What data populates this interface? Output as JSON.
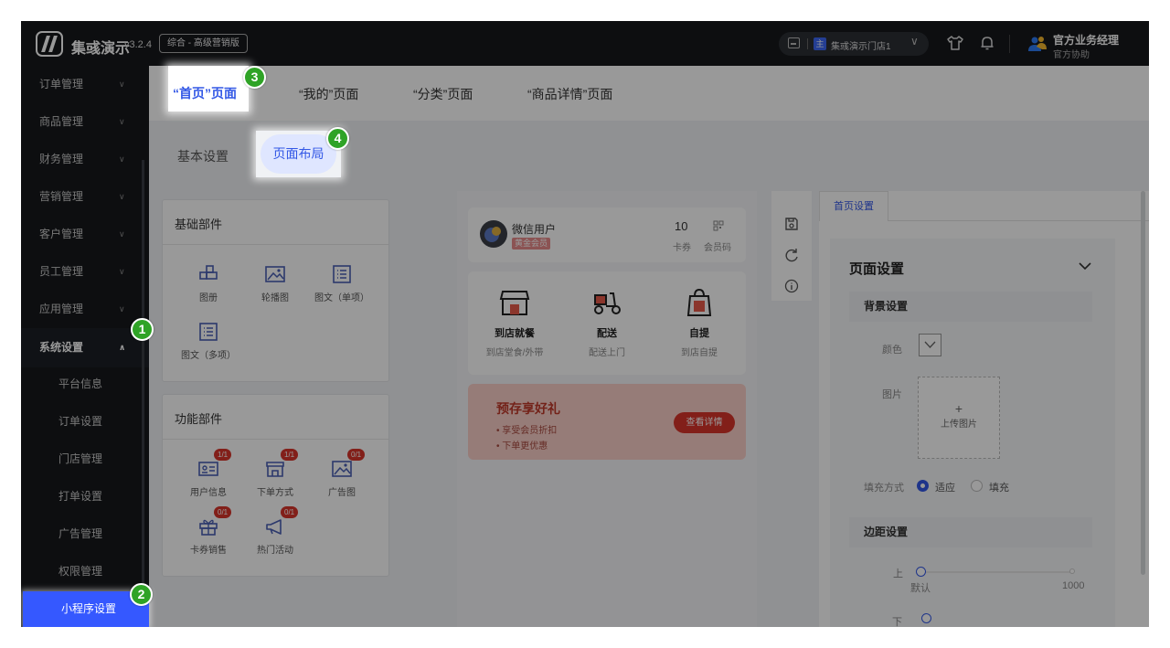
{
  "topbar": {
    "app_name": "集彧演示",
    "version": "v3.2.4",
    "edition": "综合 - 高级营销版",
    "store_badge": "主",
    "store_name": "集彧演示门店1",
    "user_name": "官方业务经理",
    "user_role": "官方协助"
  },
  "sidebar": {
    "items": [
      {
        "label": "订单管理"
      },
      {
        "label": "商品管理"
      },
      {
        "label": "财务管理"
      },
      {
        "label": "营销管理"
      },
      {
        "label": "客户管理"
      },
      {
        "label": "员工管理"
      },
      {
        "label": "应用管理"
      },
      {
        "label": "系统设置"
      }
    ],
    "subitems": [
      {
        "label": "平台信息"
      },
      {
        "label": "订单设置"
      },
      {
        "label": "门店管理"
      },
      {
        "label": "打单设置"
      },
      {
        "label": "广告管理"
      },
      {
        "label": "权限管理"
      },
      {
        "label": "小程序设置"
      }
    ]
  },
  "page_tabs": [
    "“首页”页面",
    "“我的”页面",
    "“分类”页面",
    "“商品详情”页面"
  ],
  "sub_tabs": [
    "基本设置",
    "页面布局"
  ],
  "basic_panel": {
    "title": "基础部件",
    "components": [
      "图册",
      "轮播图",
      "图文（单项）",
      "图文（多项）"
    ]
  },
  "func_panel": {
    "title": "功能部件",
    "components": [
      {
        "label": "用户信息",
        "count": "1/1"
      },
      {
        "label": "下单方式",
        "count": "1/1"
      },
      {
        "label": "广告图",
        "count": "0/1"
      },
      {
        "label": "卡券销售",
        "count": "0/1"
      },
      {
        "label": "热门活动",
        "count": "0/1"
      }
    ]
  },
  "preview": {
    "user_name": "微信用户",
    "member_level": "黄金会员",
    "coupon_count": "10",
    "coupon_label": "卡券",
    "code_label": "会员码",
    "orders": [
      {
        "title": "到店就餐",
        "sub": "到店堂食/外带"
      },
      {
        "title": "配送",
        "sub": "配送上门"
      },
      {
        "title": "自提",
        "sub": "到店自提"
      }
    ],
    "promo_title": "预存享好礼",
    "promo_line1": "• 享受会员折扣",
    "promo_line2": "• 下单更优惠",
    "promo_button": "查看详情"
  },
  "settings": {
    "tab": "首页设置",
    "title": "页面设置",
    "bg_section": "背景设置",
    "color_label": "颜色",
    "image_label": "图片",
    "upload_plus": "+",
    "upload_label": "上传图片",
    "fill_label": "填充方式",
    "fill_option1": "适应",
    "fill_option2": "填充",
    "margin_section": "边距设置",
    "top_label": "上",
    "top_default": "默认",
    "top_max": "1000",
    "bottom_label": "下"
  },
  "markers": [
    "1",
    "2",
    "3",
    "4"
  ],
  "colors": {
    "accent": "#3358e6",
    "marker": "#2fa326",
    "sidebar_bg": "#16181c",
    "active_item": "#3558ff",
    "badge_red": "#d9352b"
  }
}
